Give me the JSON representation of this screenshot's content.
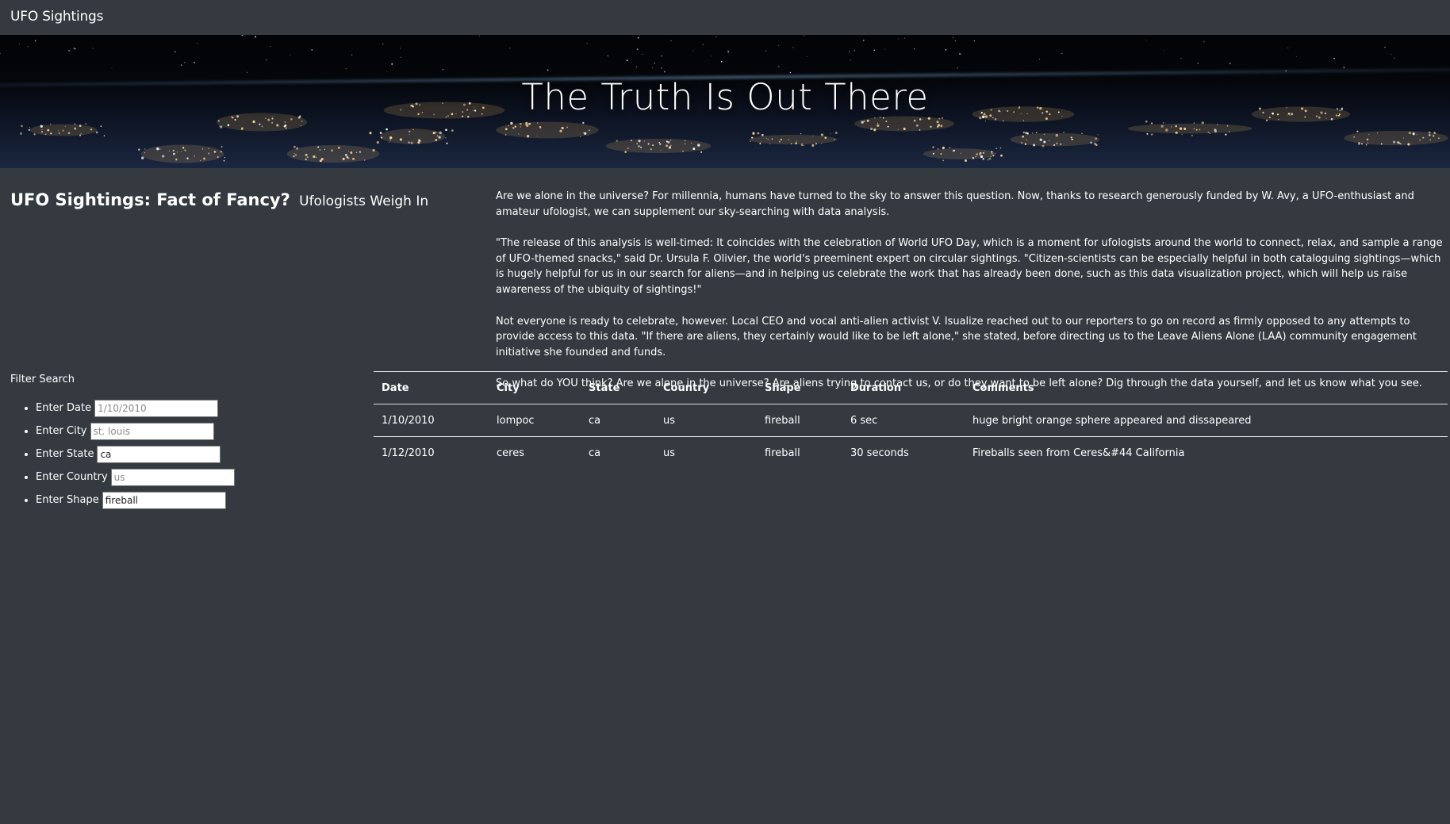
{
  "navbar": {
    "brand": "UFO Sightings"
  },
  "hero": {
    "title": "The Truth Is Out There"
  },
  "article": {
    "headline": "UFO Sightings: Fact of Fancy?",
    "subheadline": "Ufologists Weigh In",
    "paragraphs": [
      "Are we alone in the universe? For millennia, humans have turned to the sky to answer this question. Now, thanks to research generously funded by W. Avy, a UFO-enthusiast and amateur ufologist, we can supplement our sky-searching with data analysis.",
      "\"The release of this analysis is well-timed: It coincides with the celebration of World UFO Day, which is a moment for ufologists around the world to connect, relax, and sample a range of UFO-themed snacks,\" said Dr. Ursula F. Olivier, the world's preeminent expert on circular sightings. \"Citizen-scientists can be especially helpful in both cataloguing sightings—which is hugely helpful for us in our search for aliens—and in helping us celebrate the work that has already been done, such as this data visualization project, which will help us raise awareness of the ubiquity of sightings!\"",
      "Not everyone is ready to celebrate, however. Local CEO and vocal anti-alien activist V. Isualize reached out to our reporters to go on record as firmly opposed to any attempts to provide access to this data. \"If there are aliens, they certainly would like to be left alone,\" she stated, before directing us to the Leave Aliens Alone (LAA) community engagement initiative she founded and funds.",
      "So what do YOU think? Are we alone in the universe? Are aliens trying to contact us, or do they want to be left alone? Dig through the data yourself, and let us know what you see."
    ]
  },
  "filters": {
    "title": "Filter Search",
    "date": {
      "label": "Enter Date",
      "placeholder": "1/10/2010",
      "value": ""
    },
    "city": {
      "label": "Enter City",
      "placeholder": "st. louis",
      "value": ""
    },
    "state": {
      "label": "Enter State",
      "placeholder": "",
      "value": "ca"
    },
    "country": {
      "label": "Enter Country",
      "placeholder": "us",
      "value": ""
    },
    "shape": {
      "label": "Enter Shape",
      "placeholder": "",
      "value": "fireball"
    }
  },
  "table": {
    "headers": [
      "Date",
      "City",
      "State",
      "Country",
      "Shape",
      "Duration",
      "Comments"
    ],
    "rows": [
      [
        "1/10/2010",
        "lompoc",
        "ca",
        "us",
        "fireball",
        "6 sec",
        "huge bright orange sphere appeared and dissapeared"
      ],
      [
        "1/12/2010",
        "ceres",
        "ca",
        "us",
        "fireball",
        "30 seconds",
        "Fireballs seen from Ceres&#44 California"
      ]
    ]
  }
}
